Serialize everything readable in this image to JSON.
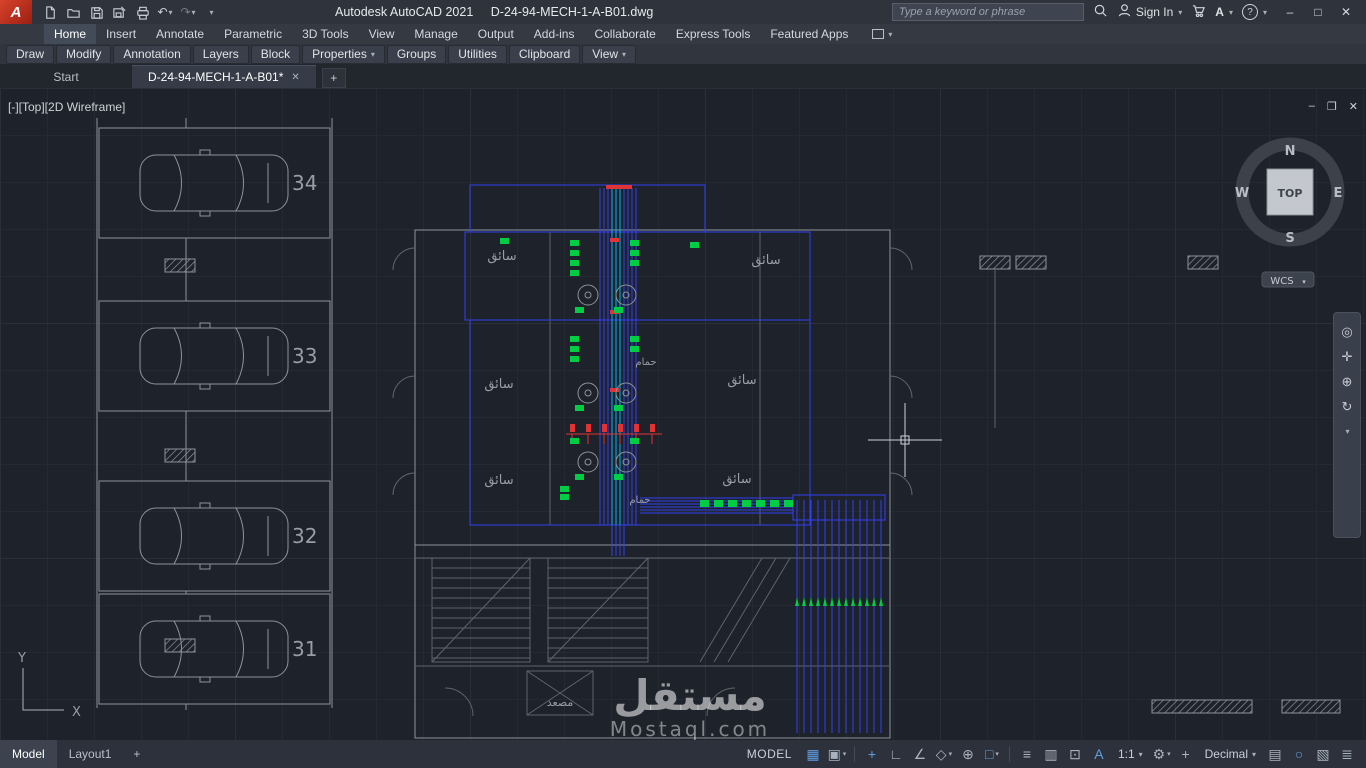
{
  "titlebar": {
    "app_title": "Autodesk AutoCAD 2021",
    "doc_name": "D-24-94-MECH-1-A-B01.dwg",
    "search_placeholder": "Type a keyword or phrase",
    "sign_in_label": "Sign In"
  },
  "ribbon": {
    "tabs": [
      "Home",
      "Insert",
      "Annotate",
      "Parametric",
      "3D Tools",
      "View",
      "Manage",
      "Output",
      "Add-ins",
      "Collaborate",
      "Express Tools",
      "Featured Apps"
    ],
    "panels": [
      "Draw",
      "Modify",
      "Annotation",
      "Layers",
      "Block",
      "Properties",
      "Groups",
      "Utilities",
      "Clipboard",
      "View"
    ]
  },
  "file_tabs": {
    "start": "Start",
    "active_doc": "D-24-94-MECH-1-A-B01*"
  },
  "viewport": {
    "label": "[-][Top][2D Wireframe]",
    "viewcube": {
      "n": "N",
      "e": "E",
      "s": "S",
      "w": "W",
      "face": "TOP"
    },
    "wcs": "WCS",
    "axis_x": "X",
    "axis_y": "Y"
  },
  "drawing": {
    "parking": [
      "34",
      "33",
      "32",
      "31"
    ],
    "labels": {
      "driver": "سائق",
      "bathroom": "حمام",
      "elevator": "مصعد"
    },
    "watermark": {
      "ar": "مستقل",
      "en": "Mostaql.com"
    }
  },
  "statusbar": {
    "model_tab": "Model",
    "layout_tab": "Layout1",
    "add_layout": "+",
    "space": "MODEL",
    "scale": "1:1",
    "units": "Decimal"
  },
  "icons": {
    "caret_down": "▾",
    "undo": "↶",
    "redo": "↷",
    "minimize": "–",
    "maximize": "□",
    "close": "✕",
    "vp_minimize": "–",
    "vp_restore": "❐",
    "vp_close": "✕",
    "tab_close": "✕",
    "new_tab": "+",
    "help": "?",
    "apps_badge": "A",
    "grid": "▦",
    "snap": "▣",
    "dynamic_input": "+",
    "ortho": "∟",
    "polar": "∠",
    "isodraft": "◇",
    "otrack": "⊕",
    "osnap": "□",
    "lineweight": "≡",
    "transparency": "▥",
    "selection_cycling": "⊡",
    "annotation_visibility": "A",
    "workspace": "⚙",
    "annotation_monitor": "+",
    "quick_properties": "▤",
    "isolate": "○",
    "graphics": "▧",
    "customize": "≣",
    "nav_wheel": "◎",
    "nav_pan": "✛",
    "nav_zoom": "⊕",
    "nav_orbit": "↻"
  }
}
